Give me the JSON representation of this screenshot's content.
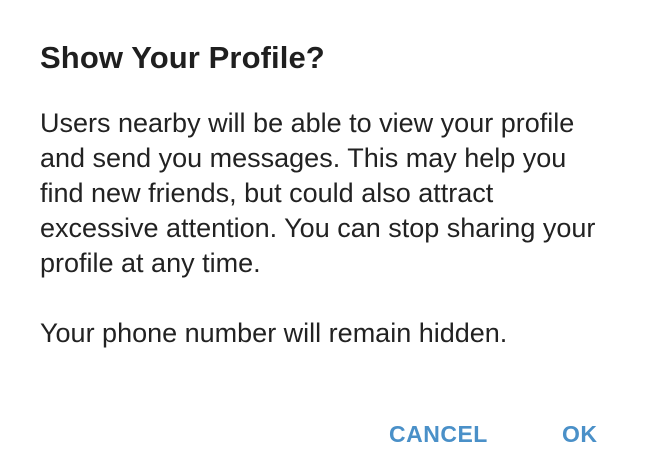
{
  "dialog": {
    "title": "Show Your Profile?",
    "message_paragraph_1": "Users nearby will be able to view your profile and send you messages. This may help you find new friends, but could also attract excessive attention. You can stop sharing your profile at any time.",
    "message_paragraph_2": "Your phone number will remain hidden.",
    "cancel_label": "CANCEL",
    "ok_label": "OK"
  },
  "colors": {
    "accent": "#4a90c8",
    "text": "#222222",
    "background": "#ffffff"
  }
}
